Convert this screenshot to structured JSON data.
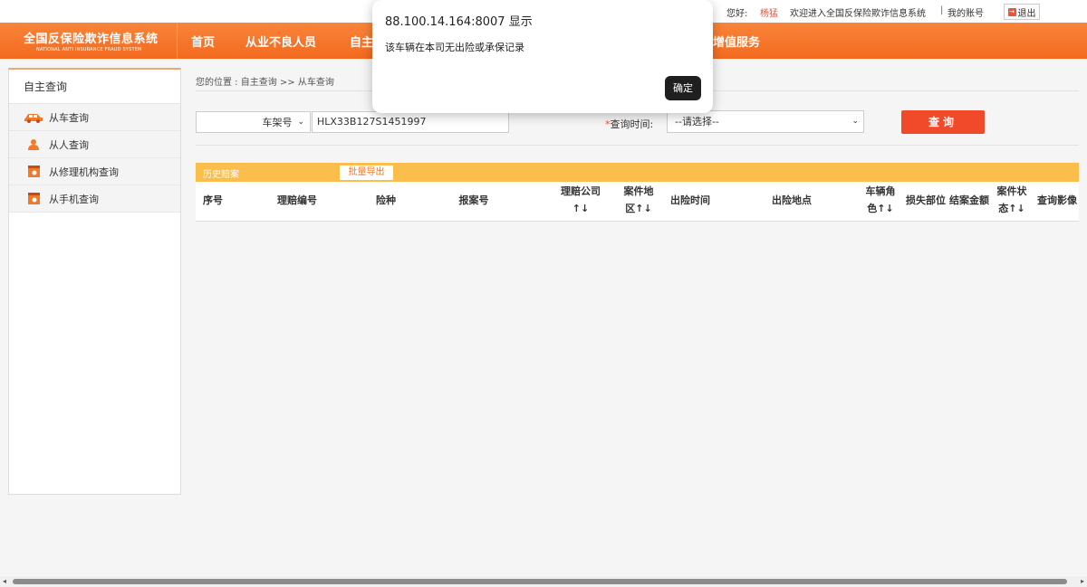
{
  "topbar": {
    "greeting": "您好:",
    "user_name": "杨猛",
    "welcome": "欢迎进入全国反保险欺诈信息系统",
    "separator": "|",
    "my_account": "我的账号",
    "logout": "退出"
  },
  "logo": {
    "title_cn": "全国反保险欺诈信息系统",
    "title_en": "NATIONAL ANTI INSURANCE FRAUD SYSTEM"
  },
  "nav": {
    "items": [
      "首页",
      "从业不良人员",
      "自主"
    ],
    "right_item": "增值服务"
  },
  "sidebar": {
    "header": "自主查询",
    "items": [
      {
        "label": "从车查询",
        "icon": "car-icon"
      },
      {
        "label": "从人查询",
        "icon": "person-icon"
      },
      {
        "label": "从修理机构查询",
        "icon": "repair-shop-icon"
      },
      {
        "label": "从手机查询",
        "icon": "phone-icon"
      }
    ]
  },
  "breadcrumb": "您的位置 : 自主查询 >> 从车查询",
  "search": {
    "type_select": "车架号",
    "vin_value": "HLX33B127S1451997",
    "time_label": "查询时间:",
    "time_star": "*",
    "time_select": "--请选择--",
    "query_button": "查询"
  },
  "history": {
    "title": "历史赔案",
    "export_button": "批量导出"
  },
  "table": {
    "columns": [
      {
        "line1": "序号",
        "line2": ""
      },
      {
        "line1": "理赔编号",
        "line2": ""
      },
      {
        "line1": "险种",
        "line2": ""
      },
      {
        "line1": "报案号",
        "line2": ""
      },
      {
        "line1": "理赔公司",
        "line2": "↑↓"
      },
      {
        "line1": "案件地",
        "line2": "区↑↓"
      },
      {
        "line1": "出险时间",
        "line2": ""
      },
      {
        "line1": "出险地点",
        "line2": ""
      },
      {
        "line1": "车辆角",
        "line2": "色↑↓"
      },
      {
        "line1": "损失部位",
        "line2": ""
      },
      {
        "line1": "结案金额",
        "line2": ""
      },
      {
        "line1": "案件状",
        "line2": "态↑↓"
      },
      {
        "line1": "查询影像",
        "line2": ""
      }
    ]
  },
  "dialog": {
    "title": "88.100.14.164:8007 显示",
    "message": "该车辆在本司无出险或承保记录",
    "ok_button": "确定"
  },
  "colors": {
    "nav_orange": "#f26a1e",
    "history_bar": "#fbbd4b",
    "query_button": "#f04a2a"
  }
}
